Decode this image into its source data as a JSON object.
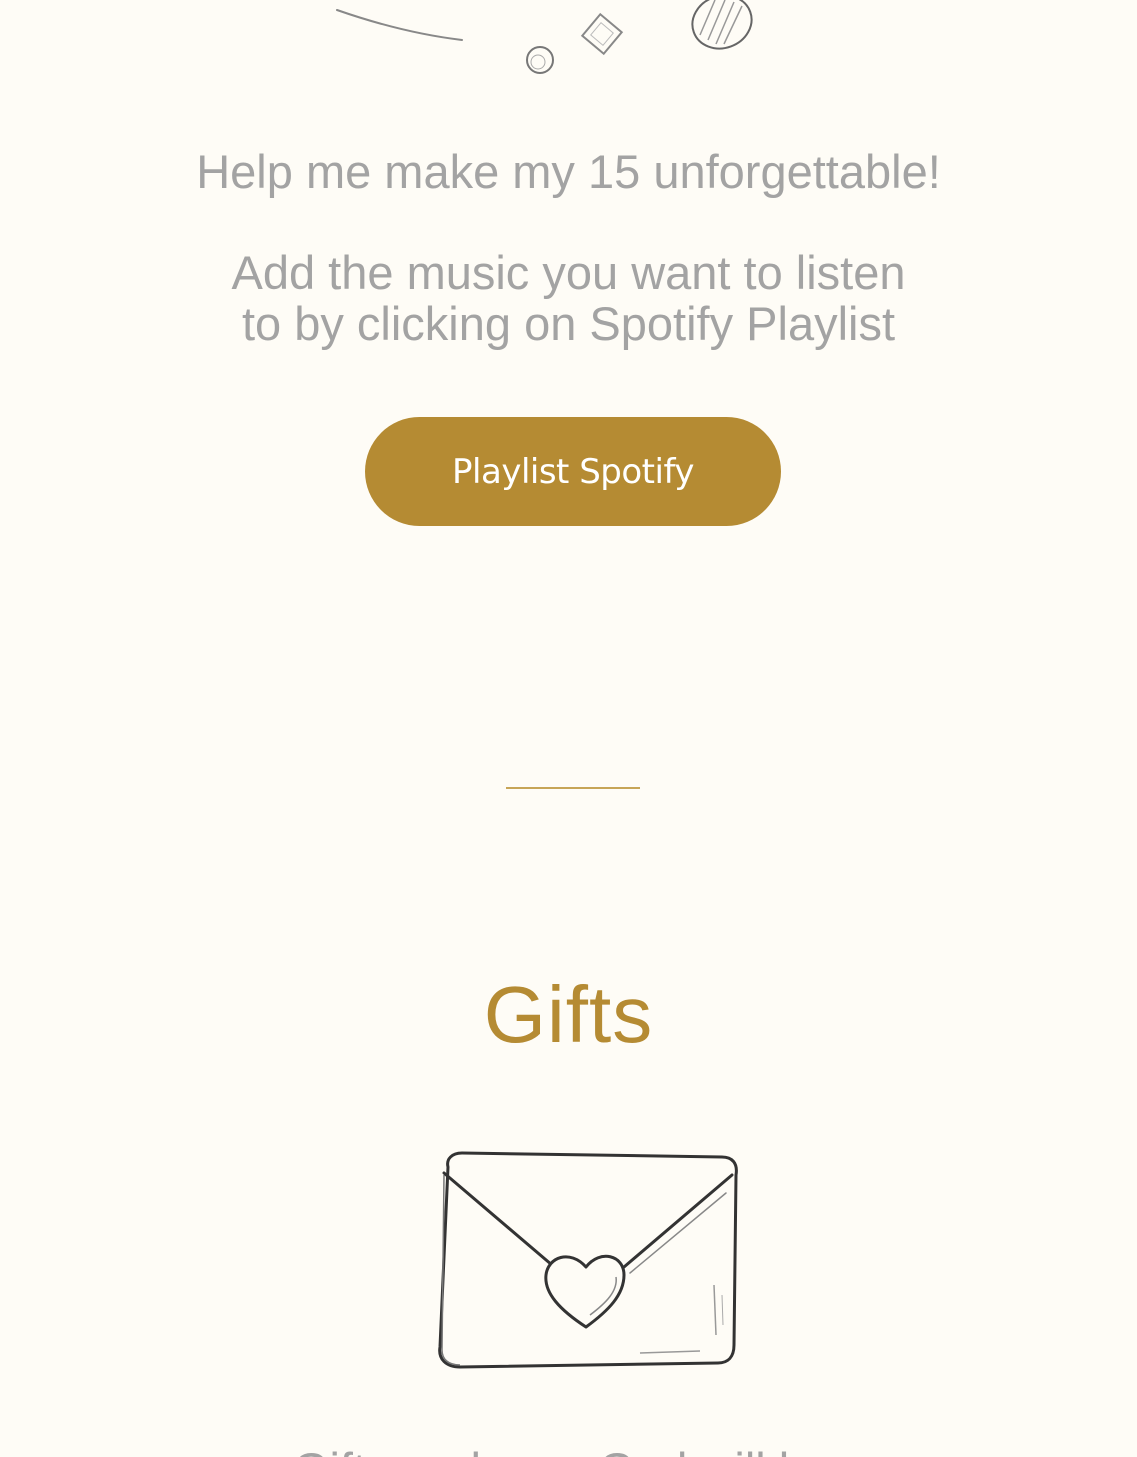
{
  "music_section": {
    "headline": "Help me make my 15 unforgettable!",
    "instruction_line1": "Add the music you want to listen",
    "instruction_line2": "to by clicking on Spotify Playlist",
    "button_label": "Playlist Spotify"
  },
  "gifts_section": {
    "title": "Gifts",
    "text_partial": "Gifts and your God will b..."
  },
  "colors": {
    "accent_gold": "#B58B33",
    "text_gray": "#A3A3A3",
    "background": "#FEFCF6",
    "divider": "#C7A557"
  },
  "icons": {
    "top_decoration": "confetti-doodle-icon",
    "gift_icon": "envelope-heart-icon"
  }
}
